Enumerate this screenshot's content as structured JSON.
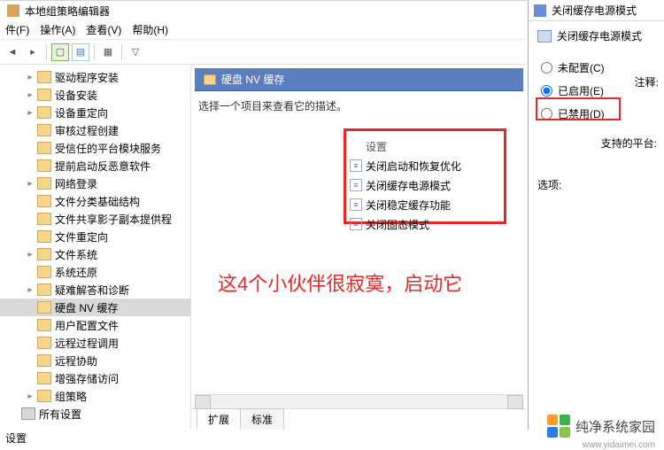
{
  "window": {
    "title": "本地组策略编辑器"
  },
  "menu": {
    "file": "件(F)",
    "action": "操作(A)",
    "view": "查看(V)",
    "help": "帮助(H)"
  },
  "tree": {
    "items": [
      "驱动程序安装",
      "设备安装",
      "设备重定向",
      "审核过程创建",
      "受信任的平台模块服务",
      "提前启动反恶意软件",
      "网络登录",
      "文件分类基础结构",
      "文件共享影子副本提供程",
      "文件重定向",
      "文件系统",
      "系统还原",
      "疑难解答和诊断",
      "硬盘 NV 缓存",
      "用户配置文件",
      "远程过程调用",
      "远程协助",
      "增强存储访问",
      "组策略"
    ],
    "all_settings": "所有设置"
  },
  "right": {
    "header": "硬盘 NV 缓存",
    "desc": "选择一个项目来查看它的描述。",
    "col_head": "设置",
    "settings": [
      "关闭启动和恢复优化",
      "关闭缓存电源模式",
      "关闭稳定缓存功能",
      "关闭固态模式"
    ],
    "annotation": "这4个小伙伴很寂寞，启动它",
    "tabs": {
      "ext": "扩展",
      "std": "标准"
    }
  },
  "status": "设置",
  "popup": {
    "title": "关闭缓存电源模式",
    "subtitle": "关闭缓存电源模式",
    "note": "注释:",
    "radios": {
      "not_configured": "未配置(C)",
      "enabled": "已启用(E)",
      "disabled": "已禁用(D)"
    },
    "platform": "支持的平台:",
    "options": "选项:"
  },
  "watermark": {
    "text": "纯净系统家园",
    "url": "www.yidaimei.com"
  }
}
